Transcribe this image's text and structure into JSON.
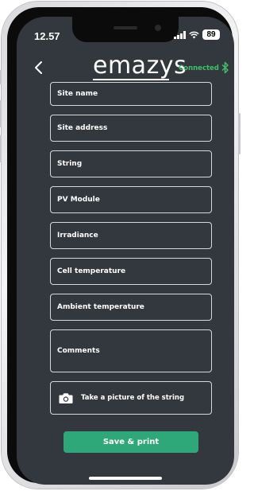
{
  "status_bar": {
    "time": "12.57",
    "battery": "89",
    "icons": [
      "signal-icon",
      "wifi-icon",
      "battery-icon"
    ]
  },
  "header": {
    "logo": "emazys",
    "connection_status": "Connected",
    "icons": [
      "back-arrow-icon",
      "bluetooth-icon"
    ]
  },
  "form": {
    "fields": [
      {
        "label": "Site name"
      },
      {
        "label": "Site address"
      },
      {
        "label": "String"
      },
      {
        "label": "PV Module"
      },
      {
        "label": "Irradiance"
      },
      {
        "label": "Cell temperature"
      },
      {
        "label": "Ambient temperature"
      },
      {
        "label": "Comments"
      }
    ],
    "photo_label": "Take a picture of the string",
    "photo_icon": "camera-icon",
    "save_label": "Save & print"
  },
  "colors": {
    "background": "#33383e",
    "accent_green": "#2ea878",
    "connected_green": "#3fbf6a",
    "text": "#ffffff"
  }
}
